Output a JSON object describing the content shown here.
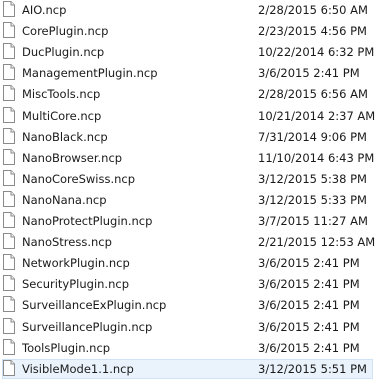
{
  "files": [
    {
      "name": "AIO.ncp",
      "modified": "2/28/2015 6:50 AM",
      "icon": "file-icon"
    },
    {
      "name": "CorePlugin.ncp",
      "modified": "2/23/2015 4:56 PM",
      "icon": "file-icon"
    },
    {
      "name": "DucPlugin.ncp",
      "modified": "10/22/2014 6:32 PM",
      "icon": "file-icon"
    },
    {
      "name": "ManagementPlugin.ncp",
      "modified": "3/6/2015 2:41 PM",
      "icon": "file-icon"
    },
    {
      "name": "MiscTools.ncp",
      "modified": "2/28/2015 6:56 AM",
      "icon": "file-icon"
    },
    {
      "name": "MultiCore.ncp",
      "modified": "10/21/2014 2:37 AM",
      "icon": "file-icon"
    },
    {
      "name": "NanoBlack.ncp",
      "modified": "7/31/2014 9:06 PM",
      "icon": "file-icon"
    },
    {
      "name": "NanoBrowser.ncp",
      "modified": "11/10/2014 6:43 PM",
      "icon": "file-icon"
    },
    {
      "name": "NanoCoreSwiss.ncp",
      "modified": "3/12/2015 5:38 PM",
      "icon": "file-icon"
    },
    {
      "name": "NanoNana.ncp",
      "modified": "3/12/2015 5:33 PM",
      "icon": "file-icon"
    },
    {
      "name": "NanoProtectPlugin.ncp",
      "modified": "3/7/2015 11:27 AM",
      "icon": "file-icon"
    },
    {
      "name": "NanoStress.ncp",
      "modified": "2/21/2015 12:53 AM",
      "icon": "file-icon"
    },
    {
      "name": "NetworkPlugin.ncp",
      "modified": "3/6/2015 2:41 PM",
      "icon": "file-icon"
    },
    {
      "name": "SecurityPlugin.ncp",
      "modified": "3/6/2015 2:41 PM",
      "icon": "file-icon"
    },
    {
      "name": "SurveillanceExPlugin.ncp",
      "modified": "3/6/2015 2:41 PM",
      "icon": "file-icon"
    },
    {
      "name": "SurveillancePlugin.ncp",
      "modified": "3/6/2015 2:41 PM",
      "icon": "file-icon"
    },
    {
      "name": "ToolsPlugin.ncp",
      "modified": "3/6/2015 2:41 PM",
      "icon": "file-icon"
    },
    {
      "name": "VisibleMode1.1.ncp",
      "modified": "3/12/2015 5:51 PM",
      "icon": "file-icon",
      "selected": true
    }
  ],
  "colors": {
    "selection_fill": "#eaf3fc",
    "selection_border": "#cfe3f7",
    "text": "#1a1a1a"
  }
}
